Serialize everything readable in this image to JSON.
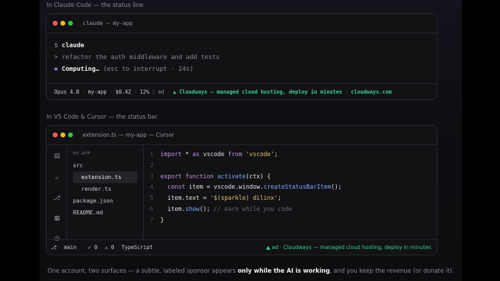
{
  "captions": {
    "claude_code": "In Claude Code — the status line",
    "vscode": "In VS Code & Cursor — the status bar"
  },
  "terminal": {
    "title": "claude — my-app",
    "prompt_symbol": "$",
    "command": "claude",
    "input_prefix": ">",
    "input": "refactor the auth middleware and add tests",
    "spinner_icon": "spinner-dot",
    "working_label": "Computing…",
    "working_hint": "(esc to interrupt · 24s)",
    "status": {
      "model": "Opus 4.8",
      "project": "my-app",
      "cost": "$0.42",
      "context": "12%",
      "ad_label": "ad",
      "ad_icon": "▲",
      "ad_text": "Cloudways — managed cloud hosting, deploy in minutes",
      "ad_domain": "cloudways.com"
    }
  },
  "editor": {
    "title": "extension.ts — my-app — Cursor",
    "activity_icons": [
      "files-icon",
      "search-icon",
      "source-control-icon",
      "extensions-icon",
      "clock-icon"
    ],
    "explorer_title": "MY-APP",
    "files": [
      "src",
      "extension.ts",
      "render.ts",
      "package.json",
      "README.md"
    ],
    "code": {
      "l1": [
        "import",
        " * ",
        "as",
        " vscode ",
        "from",
        " ",
        "'vscode'",
        ";"
      ],
      "l3": [
        "export",
        " ",
        "function",
        " ",
        "activate",
        "(ctx) {"
      ],
      "l4": [
        "  ",
        "const",
        " item = vscode.window.",
        "createStatusBarItem",
        "();"
      ],
      "l5": [
        "  item.text = ",
        "'$(sparkle) dilinx'",
        ";"
      ],
      "l6": [
        "  item.",
        "show",
        "(); ",
        "// earn while you code"
      ],
      "l7": [
        "}"
      ]
    },
    "line_numbers": [
      "1",
      "2",
      "3",
      "4",
      "5",
      "6",
      "7"
    ],
    "status": {
      "branch_icon": "⎇",
      "branch": "main",
      "errors": "✓ 0",
      "warnings": "⚠ 0",
      "language": "TypeScript",
      "ad_icon": "▲",
      "ad_label": "ad",
      "ad_text": "Cloudways — managed cloud hosting, deploy in minutes"
    }
  },
  "footer": {
    "before": "One account, two surfaces — a subtle, labeled sponsor appears ",
    "bold": "only while the AI is working",
    "after": ", and you keep the revenue (or donate it)."
  }
}
